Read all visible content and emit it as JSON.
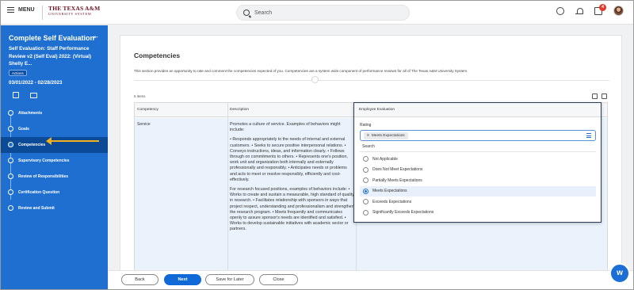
{
  "topbar": {
    "menu_label": "MENU",
    "logo_line1": "THE TEXAS A&M",
    "logo_line2": "UNIVERSITY SYSTEM",
    "search_placeholder": "Search",
    "inbox_badge": "4"
  },
  "sidebar": {
    "title": "Complete Self Evaluation",
    "subtitle": "Self Evaluation: Staff Performance Review v2 (Self Eval) 2022: (Virtual) Shelly E...",
    "actions_label": "Actions",
    "dates": "03/01/2022 - 02/28/2023",
    "steps": [
      {
        "label": "Attachments"
      },
      {
        "label": "Goals"
      },
      {
        "label": "Competencies",
        "active": true
      },
      {
        "label": "Supervisory Competencies"
      },
      {
        "label": "Review of Responsibilities"
      },
      {
        "label": "Certification Question"
      },
      {
        "label": "Review and Submit"
      }
    ]
  },
  "main": {
    "title": "Competencies",
    "description": "This section provides an opportunity to rate and comment the competencies expected of you. Competencies are a system wide component of performance reviews for all of The Texas A&M University System.",
    "items_count": "5 items",
    "table": {
      "headers": [
        "Competency",
        "Description",
        "Employee Evaluation"
      ],
      "row": {
        "competency": "Service",
        "description": [
          "Promotes a culture of service. Examples of behaviors might include:",
          "• Responds appropriately to the needs of internal and external customers. • Seeks to secure positive interpersonal relations. • Conveys instructions, ideas, and information clearly. • Follows through on commitments to others. • Represents one's position, work unit and organization both internally and externally professionally and responsibly. • Anticipates needs or problems and acts to meet or resolve responsibly, efficiently and cost-effectively.",
          "For research focused positions, examples of behaviors include: • Works to create and sustain a measurable, high standard of quality in research. • Facilitates relationship with sponsors in ways that project respect, understanding and professionalism and strengthen the research program. • Meets frequently and communicates openly to assure sponsor's needs are identified and satisfied. • Works to develop sustainable initiatives with academic sector or partners."
        ]
      }
    },
    "evaluation": {
      "header": "Employee Evaluation",
      "rating_label": "Rating",
      "selected_chip": "Meets Expectations",
      "search_text": "Search",
      "options": [
        {
          "label": "Not Applicable",
          "selected": false
        },
        {
          "label": "Does Not Meet Expectations",
          "selected": false
        },
        {
          "label": "Partially Meets Expectations",
          "selected": false
        },
        {
          "label": "Meets Expectations",
          "selected": true
        },
        {
          "label": "Exceeds Expectations",
          "selected": false
        },
        {
          "label": "Significantly Exceeds Expectations",
          "selected": false
        }
      ]
    }
  },
  "footer": {
    "back_label": "Back",
    "next_label": "Next",
    "save_label": "Save for Later",
    "close_label": "Close"
  },
  "colors": {
    "sidebar_blue": "#1e6fd0",
    "active_step": "#0b4a96",
    "arrow": "#f3b11d",
    "primary_button": "#0f6ad8",
    "badge": "#de3b2c"
  }
}
